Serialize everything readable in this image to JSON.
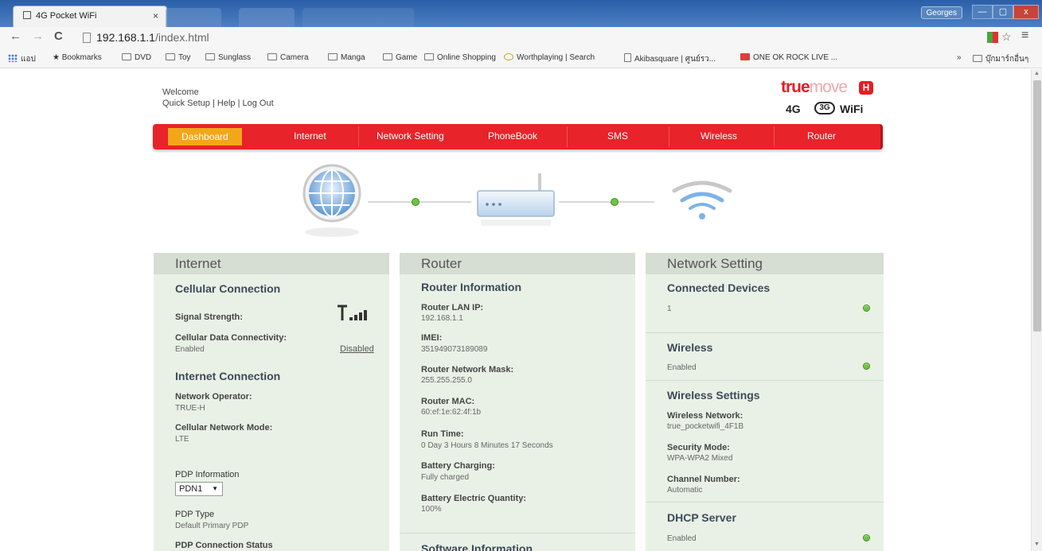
{
  "browser": {
    "tab_title": "4G Pocket WiFi",
    "tab_close": "×",
    "user_label": "Georges",
    "url_host": "192.168.1.1",
    "url_path": "/index.html",
    "nav_back": "←",
    "nav_forward": "→",
    "nav_reload": "C",
    "star": "☆",
    "menu": "≡",
    "win_min": "—",
    "win_max": "▢",
    "win_close": "x",
    "bookmarks": {
      "apps_label": "แอป",
      "items": [
        "Bookmarks",
        "DVD",
        "Toy",
        "Sunglass",
        "Camera",
        "Manga",
        "Game",
        "Online Shopping",
        "Worthplaying | Search",
        "Akibasquare | ศูนย์รว...",
        "ONE OK ROCK LIVE ..."
      ],
      "overflow": "»",
      "other": "บุ๊กมาร์กอื่นๆ"
    }
  },
  "header": {
    "welcome": "Welcome",
    "quick_setup": "Quick Setup",
    "help": "Help",
    "logout": "Log Out",
    "sep": " | "
  },
  "brand": {
    "word_true": "true",
    "word_move": "move",
    "h": "H",
    "g4": "4G",
    "g3": "3G",
    "wifi": "WiFi"
  },
  "nav": {
    "items": [
      "Dashboard",
      "Internet",
      "Network Setting",
      "PhoneBook",
      "SMS",
      "Wireless",
      "Router"
    ]
  },
  "panels": {
    "internet": {
      "header": "Internet",
      "cellular_title": "Cellular Connection",
      "signal_label": "Signal Strength:",
      "data_label": "Cellular Data Connectivity:",
      "data_value": "Enabled",
      "data_toggle": "Disabled",
      "inet_title": "Internet Connection",
      "operator_label": "Network Operator:",
      "operator_value": "TRUE-H",
      "mode_label": "Cellular Network Mode:",
      "mode_value": "LTE",
      "pdp_label": "PDP Information",
      "pdp_select": "PDN1",
      "pdp_type_label": "PDP Type",
      "pdp_type_value": "Default Primary PDP",
      "pdp_status_label": "PDP Connection Status"
    },
    "router": {
      "header": "Router",
      "info_title": "Router Information",
      "lanip_label": "Router LAN IP:",
      "lanip_value": "192.168.1.1",
      "imei_label": "IMEI:",
      "imei_value": "351949073189089",
      "mask_label": "Router Network Mask:",
      "mask_value": "255.255.255.0",
      "mac_label": "Router MAC:",
      "mac_value": "60:ef:1e:62:4f:1b",
      "runtime_label": "Run Time:",
      "runtime_value": "0 Day 3 Hours 8 Minutes 17 Seconds",
      "charging_label": "Battery Charging:",
      "charging_value": "Fully charged",
      "quantity_label": "Battery Electric Quantity:",
      "quantity_value": "100%",
      "software_title": "Software Information"
    },
    "network": {
      "header": "Network Setting",
      "devices_title": "Connected Devices",
      "devices_value": "1",
      "wireless_title": "Wireless",
      "wireless_value": "Enabled",
      "wset_title": "Wireless Settings",
      "wnet_label": "Wireless Network:",
      "wnet_value": "true_pocketwifi_4F1B",
      "sec_label": "Security Mode:",
      "sec_value": "WPA-WPA2 Mixed",
      "chan_label": "Channel Number:",
      "chan_value": "Automatic",
      "dhcp_title": "DHCP Server",
      "dhcp_value": "Enabled"
    }
  },
  "signal_bars": 4,
  "colors": {
    "nav_red": "#e8232a",
    "nav_active": "#f2a71b",
    "status_green": "#70c440",
    "panel_bg": "#e9f1e6",
    "panel_header": "#d6ddd3"
  }
}
